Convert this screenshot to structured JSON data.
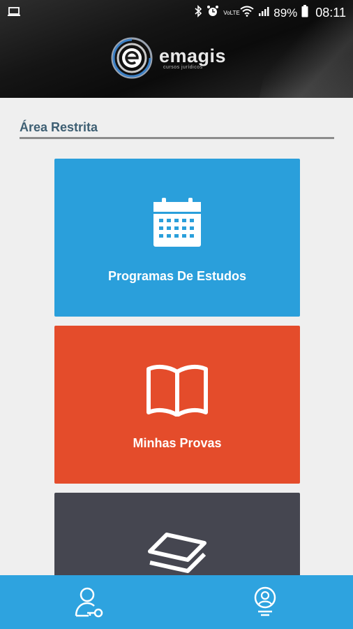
{
  "status_bar": {
    "battery_percent": "89%",
    "time": "08:11",
    "network_label": "VoLTE",
    "icons": [
      "laptop-icon",
      "bluetooth-icon",
      "alarm-icon",
      "volte-icon",
      "wifi-icon",
      "signal-icon",
      "battery-icon"
    ]
  },
  "brand": {
    "name": "emagis",
    "tagline": "cursos jurídicos"
  },
  "section": {
    "title": "Área Restrita"
  },
  "cards": [
    {
      "label": "Programas De Estudos",
      "icon": "calendar-icon",
      "color": "#2a9fdb"
    },
    {
      "label": "Minhas Provas",
      "icon": "open-book-icon",
      "color": "#e44c2b"
    },
    {
      "label": "",
      "icon": "layers-icon",
      "color": "#454650"
    }
  ],
  "bottom_nav": {
    "color": "#2ea3df",
    "items": [
      {
        "icon": "user-key-icon"
      },
      {
        "icon": "user-profile-icon"
      }
    ]
  }
}
